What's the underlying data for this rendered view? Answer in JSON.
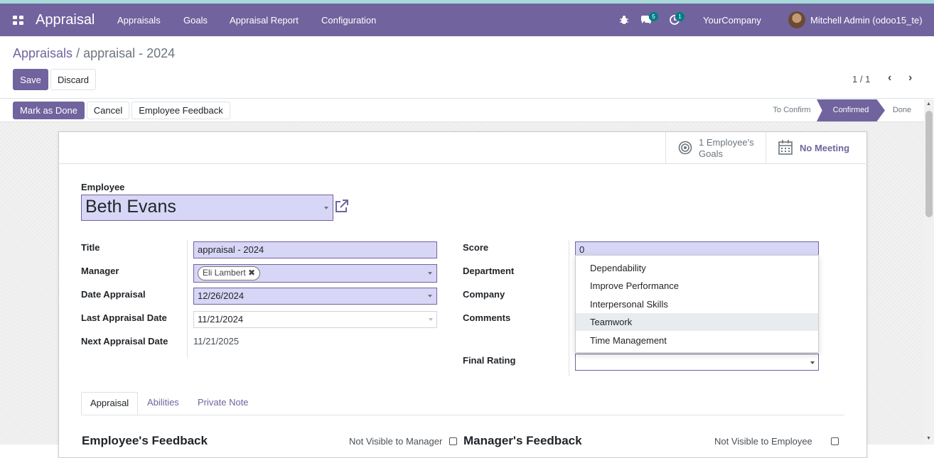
{
  "navbar": {
    "app_name": "Appraisal",
    "menu": [
      "Appraisals",
      "Goals",
      "Appraisal Report",
      "Configuration"
    ],
    "messages_count": "5",
    "activities_count": "1",
    "company": "YourCompany",
    "user": "Mitchell Admin (odoo15_te)",
    "color": "#71639e"
  },
  "breadcrumb": {
    "parent": "Appraisals",
    "current": "appraisal - 2024"
  },
  "actions": {
    "save": "Save",
    "discard": "Discard"
  },
  "pager": {
    "value": "1 / 1"
  },
  "header_buttons": {
    "mark_done": "Mark as Done",
    "cancel": "Cancel",
    "feedback": "Employee Feedback"
  },
  "statusbar": {
    "steps": [
      "To Confirm",
      "Confirmed",
      "Done"
    ],
    "active": "Confirmed"
  },
  "smart_buttons": {
    "goals": "1 Employee's",
    "goals_line2": "Goals",
    "meeting": "No Meeting"
  },
  "form": {
    "employee_label": "Employee",
    "employee_value": "Beth Evans",
    "title_label": "Title",
    "title_value": "appraisal - 2024",
    "manager_label": "Manager",
    "manager_tag": "Eli Lambert",
    "date_label": "Date Appraisal",
    "date_value": "12/26/2024",
    "last_label": "Last Appraisal Date",
    "last_value": "11/21/2024",
    "next_label": "Next Appraisal Date",
    "next_value": "11/21/2025",
    "score_label": "Score",
    "score_value": "0",
    "department_label": "Department",
    "company_label": "Company",
    "comments_label": "Comments",
    "final_rating_label": "Final Rating"
  },
  "dropdown_options": [
    "Dependability",
    "Improve Performance",
    "Interpersonal Skills",
    "Teamwork",
    "Time Management"
  ],
  "tabs": [
    "Appraisal",
    "Abilities",
    "Private Note"
  ],
  "sections": {
    "employee_feedback": "Employee's Feedback",
    "not_visible_manager": "Not Visible to Manager",
    "manager_feedback": "Manager's Feedback",
    "not_visible_employee": "Not Visible to Employee"
  }
}
